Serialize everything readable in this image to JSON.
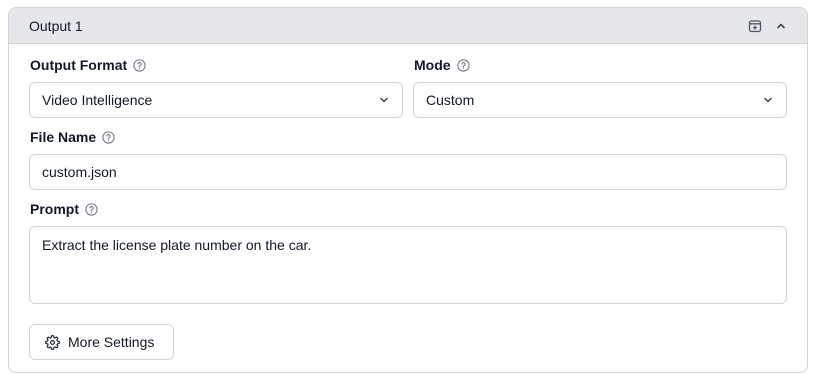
{
  "panel": {
    "title": "Output 1",
    "header_icons": [
      "archive-plus-icon",
      "chevron-up-icon"
    ]
  },
  "output_format": {
    "label": "Output Format",
    "value": "Video Intelligence"
  },
  "mode": {
    "label": "Mode",
    "value": "Custom"
  },
  "file_name": {
    "label": "File Name",
    "value": "custom.json"
  },
  "prompt": {
    "label": "Prompt",
    "value": "Extract the license plate number on the car."
  },
  "more_settings": {
    "label": "More Settings",
    "icon": "gear-icon"
  },
  "colors": {
    "header_bg": "#e5e7eb",
    "border": "#d1d5db",
    "text": "#111827"
  }
}
